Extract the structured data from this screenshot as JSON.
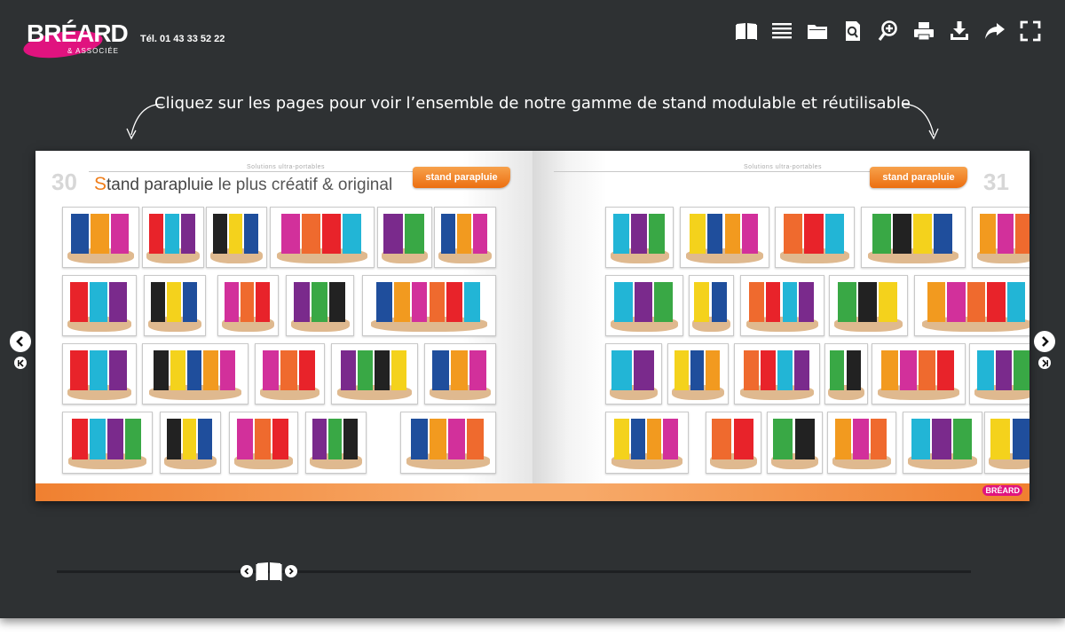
{
  "header": {
    "logo_name": "BRÉARD",
    "logo_sub": "& ASSOCIÉE",
    "phone": "Tél. 01 43 33 52 22"
  },
  "toolbar": {
    "icons": [
      "book-icon",
      "list-icon",
      "folder-icon",
      "page-search-icon",
      "zoom-in-icon",
      "print-icon",
      "download-icon",
      "share-icon",
      "fullscreen-icon"
    ]
  },
  "instruction": "Cliquez sur les pages pour voir l’ensemble de notre gamme de stand modulable et réutilisable",
  "book": {
    "left_page": {
      "number": "30",
      "section": "Solutions ultra-portables",
      "heading_s": "S",
      "heading_bold": "tand parapluie",
      "heading_rest": " le plus créatif & original",
      "tag": "stand parapluie"
    },
    "right_page": {
      "number": "31",
      "section": "Solutions ultra-portables",
      "tag": "stand parapluie",
      "brand": "BRÉARD"
    }
  },
  "colors": {
    "background": "#2e3133",
    "accent_orange": "#f07e1b",
    "brand_pink": "#e0137f"
  },
  "navigation": {
    "prev_icon": "chevron-left-icon",
    "next_icon": "chevron-right-icon",
    "first_icon": "first-page-icon",
    "last_icon": "last-page-icon"
  }
}
